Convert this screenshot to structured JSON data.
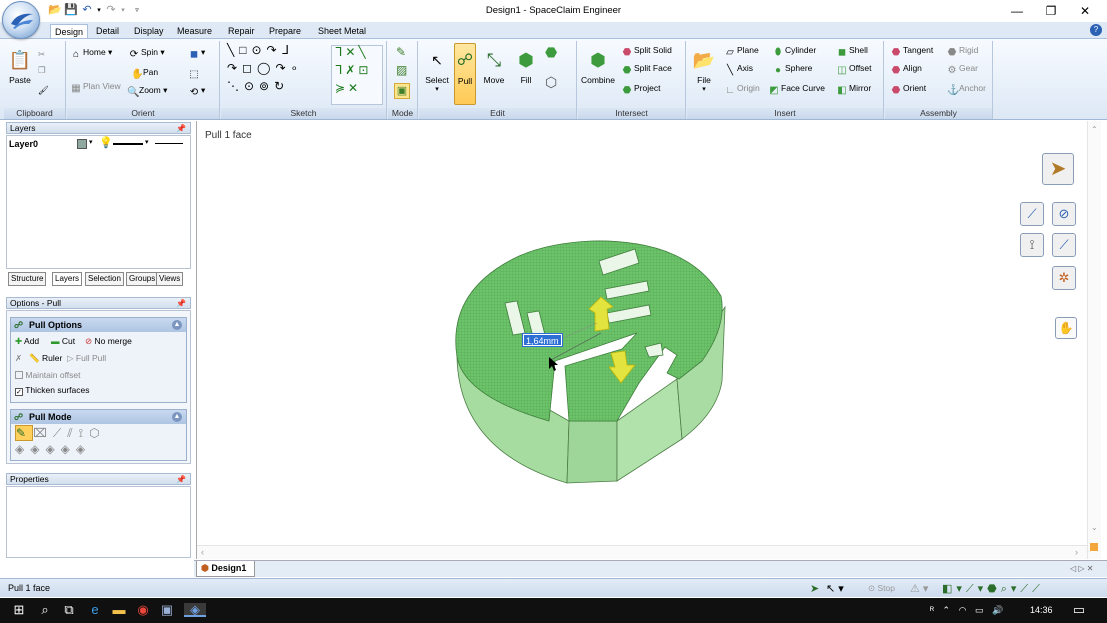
{
  "window": {
    "title": "Design1 - SpaceClaim Engineer",
    "minimize": "—",
    "restore": "❐",
    "close": "✕"
  },
  "tabs": [
    {
      "label": "Design",
      "active": true
    },
    {
      "label": "Detail"
    },
    {
      "label": "Display"
    },
    {
      "label": "Measure"
    },
    {
      "label": "Repair"
    },
    {
      "label": "Prepare"
    },
    {
      "label": "Sheet Metal"
    }
  ],
  "ribbon": {
    "clipboard": {
      "label": "Clipboard",
      "paste": "Paste"
    },
    "orient": {
      "label": "Orient",
      "home": "Home",
      "spin": "Spin",
      "pan": "Pan",
      "plan_view": "Plan View",
      "zoom": "Zoom"
    },
    "sketch": {
      "label": "Sketch"
    },
    "mode": {
      "label": "Mode"
    },
    "edit": {
      "label": "Edit",
      "select": "Select",
      "pull": "Pull",
      "move": "Move",
      "fill": "Fill"
    },
    "intersect": {
      "label": "Intersect",
      "combine": "Combine",
      "split_solid": "Split Solid",
      "split_face": "Split Face",
      "project": "Project"
    },
    "insert": {
      "label": "Insert",
      "file": "File",
      "plane": "Plane",
      "axis": "Axis",
      "origin": "Origin",
      "cylinder": "Cylinder",
      "sphere": "Sphere",
      "face_curve": "Face Curve",
      "shell": "Shell",
      "offset": "Offset",
      "mirror": "Mirror"
    },
    "assembly": {
      "label": "Assembly",
      "tangent": "Tangent",
      "align": "Align",
      "orient": "Orient",
      "rigid": "Rigid",
      "gear": "Gear",
      "anchor": "Anchor"
    }
  },
  "layers_panel": {
    "title": "Layers",
    "layer_name": "Layer0"
  },
  "panel_tabs": [
    "Structure",
    "Layers",
    "Selection",
    "Groups",
    "Views"
  ],
  "options_panel": {
    "title": "Options - Pull",
    "pull_options": {
      "title": "Pull Options",
      "add": "Add",
      "cut": "Cut",
      "no_merge": "No merge",
      "ruler": "Ruler",
      "full_pull": "Full Pull",
      "maintain_offset": "Maintain offset",
      "thicken_surfaces": "Thicken surfaces"
    },
    "pull_mode": {
      "title": "Pull Mode"
    }
  },
  "properties_panel": {
    "title": "Properties"
  },
  "viewport": {
    "hint": "Pull 1 face",
    "dimension": "1,64mm"
  },
  "doc_tab": {
    "label": "Design1"
  },
  "statusbar": {
    "text": "Pull 1 face",
    "stop": "Stop"
  },
  "taskbar": {
    "time": "14:36"
  },
  "colors": {
    "model_top": "#6cc46a",
    "model_side": "#a6dca0",
    "ribbon_bg": "#dde8f5",
    "accent": "#3a7fd5"
  }
}
